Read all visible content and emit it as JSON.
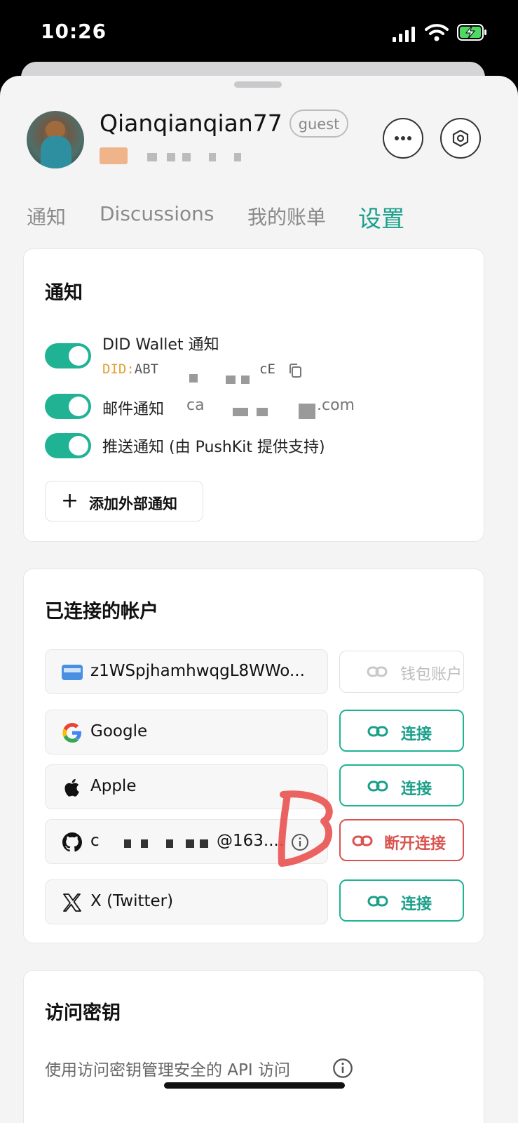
{
  "status": {
    "time": "10:26"
  },
  "profile": {
    "username": "Qianqianqian77",
    "role_badge": "guest"
  },
  "tabs": [
    {
      "label": "通知",
      "active": false
    },
    {
      "label": "Discussions",
      "active": false
    },
    {
      "label": "我的账单",
      "active": false
    },
    {
      "label": "设置",
      "active": true
    }
  ],
  "notifications": {
    "title": "通知",
    "items": [
      {
        "label": "DID Wallet 通知",
        "sub_prefix": "DID:",
        "sub_value": "ABT",
        "sub_suffix": "cE",
        "enabled": true
      },
      {
        "label": "邮件通知",
        "value_prefix": "ca",
        "value_suffix": ".com",
        "enabled": true
      },
      {
        "label": "推送通知 (由 PushKit 提供支持)",
        "enabled": true
      }
    ],
    "add_button": "添加外部通知"
  },
  "connected": {
    "title": "已连接的帐户",
    "accounts": [
      {
        "name": "z1WSpjhamhwqgL8WWo...",
        "icon": "wallet-card-icon",
        "action": "钱包账户",
        "action_state": "disabled"
      },
      {
        "name": "Google",
        "icon": "google-icon",
        "action": "连接",
        "action_state": "connect"
      },
      {
        "name": "Apple",
        "icon": "apple-icon",
        "action": "连接",
        "action_state": "connect"
      },
      {
        "name_prefix": "c",
        "name_suffix": "@163....",
        "icon": "github-icon",
        "action": "断开连接",
        "action_state": "disconnect"
      },
      {
        "name": "X (Twitter)",
        "icon": "x-icon",
        "action": "连接",
        "action_state": "connect"
      }
    ]
  },
  "access_keys": {
    "title": "访问密钥",
    "description": "使用访问密钥管理安全的 API 访问"
  },
  "colors": {
    "accent": "#1aa08a",
    "toggle": "#1fb394",
    "danger": "#d9534f"
  }
}
